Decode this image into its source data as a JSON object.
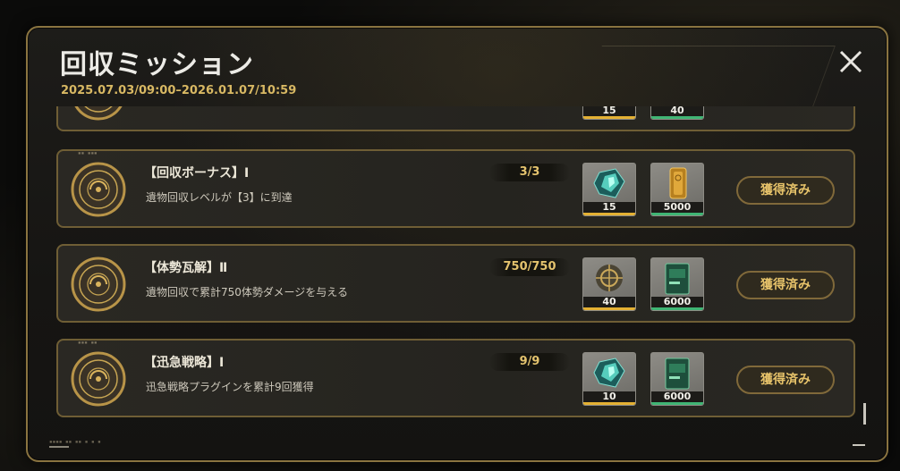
{
  "header": {
    "title": "回収ミッション",
    "period": "2025.07.03/09:00–2026.01.07/10:59"
  },
  "close_icon": "close-x-icon",
  "missions": [
    {
      "title": "",
      "description": "",
      "progress": "",
      "rewards": [
        {
          "icon": "crystal-icon",
          "qty": "15",
          "bar": "yellow"
        },
        {
          "icon": "gold-bar-icon",
          "qty": "40",
          "bar": "green"
        }
      ],
      "status": ""
    },
    {
      "title": "【回収ボーナス】Ⅰ",
      "description": "遺物回収レベルが【3】に到達",
      "progress": "3/3",
      "rewards": [
        {
          "icon": "crystal-icon",
          "qty": "15",
          "bar": "yellow"
        },
        {
          "icon": "gold-bar-icon",
          "qty": "5000",
          "bar": "green"
        }
      ],
      "status": "獲得済み"
    },
    {
      "title": "【体勢瓦解】Ⅱ",
      "description": "遺物回収で累計750体勢ダメージを与える",
      "progress": "750/750",
      "rewards": [
        {
          "icon": "relic-emblem-icon",
          "qty": "40",
          "bar": "yellow"
        },
        {
          "icon": "plugin-card-icon",
          "qty": "6000",
          "bar": "green"
        }
      ],
      "status": "獲得済み"
    },
    {
      "title": "【迅急戦略】Ⅰ",
      "description": "迅急戦略プラグインを累計9回獲得",
      "progress": "9/9",
      "rewards": [
        {
          "icon": "crystal-icon",
          "qty": "10",
          "bar": "yellow"
        },
        {
          "icon": "plugin-card-icon",
          "qty": "6000",
          "bar": "green"
        }
      ],
      "status": "獲得済み"
    }
  ],
  "colors": {
    "accent_gold": "#e4c36e",
    "frame": "#8a7440",
    "rarity_yellow": "#e4b133",
    "rarity_green": "#3fb574"
  }
}
